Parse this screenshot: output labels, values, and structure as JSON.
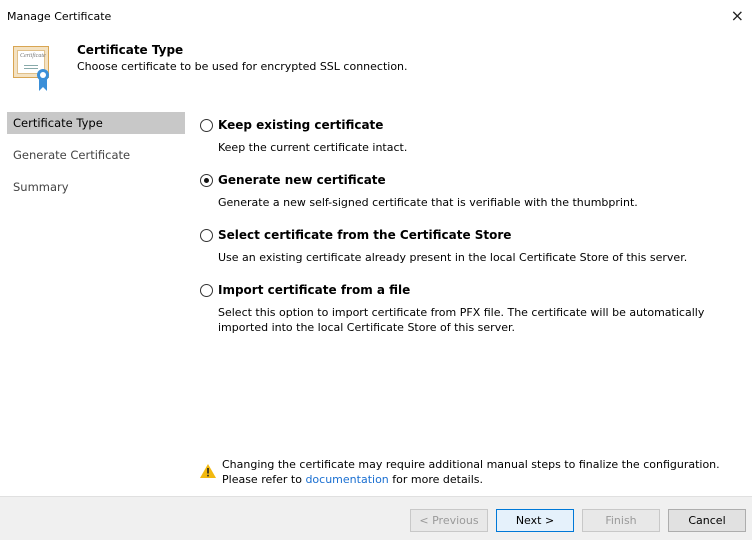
{
  "window": {
    "title": "Manage Certificate",
    "close_glyph": "×"
  },
  "header": {
    "title": "Certificate Type",
    "description": "Choose certificate to be used for encrypted SSL connection.",
    "icon": "certificate-icon",
    "icon_word": "Certificate"
  },
  "sidebar": {
    "items": [
      {
        "label": "Certificate Type",
        "active": true
      },
      {
        "label": "Generate Certificate",
        "active": false
      },
      {
        "label": "Summary",
        "active": false
      }
    ]
  },
  "options": [
    {
      "label": "Keep existing certificate",
      "description": "Keep the current certificate intact.",
      "checked": false
    },
    {
      "label": "Generate new certificate",
      "description": "Generate a new self-signed certificate that is verifiable with the thumbprint.",
      "checked": true
    },
    {
      "label": "Select certificate from the Certificate Store",
      "description": "Use an existing certificate already present in the local Certificate Store of this server.",
      "checked": false
    },
    {
      "label": "Import certificate from a file",
      "description": "Select this option to import certificate from PFX file. The certificate will be automatically imported into the local Certificate Store of this server.",
      "checked": false
    }
  ],
  "note": {
    "line1": "Changing the certificate may require additional manual steps to finalize the configuration.",
    "line2_prefix": "Please refer to",
    "link_text": "documentation",
    "line2_suffix": "for more details.",
    "icon": "warning-icon"
  },
  "footer": {
    "previous_label": "< Previous",
    "next_label": "Next >",
    "finish_label": "Finish",
    "cancel_label": "Cancel"
  },
  "colors": {
    "accent": "#0078d7",
    "link": "#1a6fd1",
    "warning": "#f2b90f",
    "sidebar_active": "#c8c8c8"
  }
}
